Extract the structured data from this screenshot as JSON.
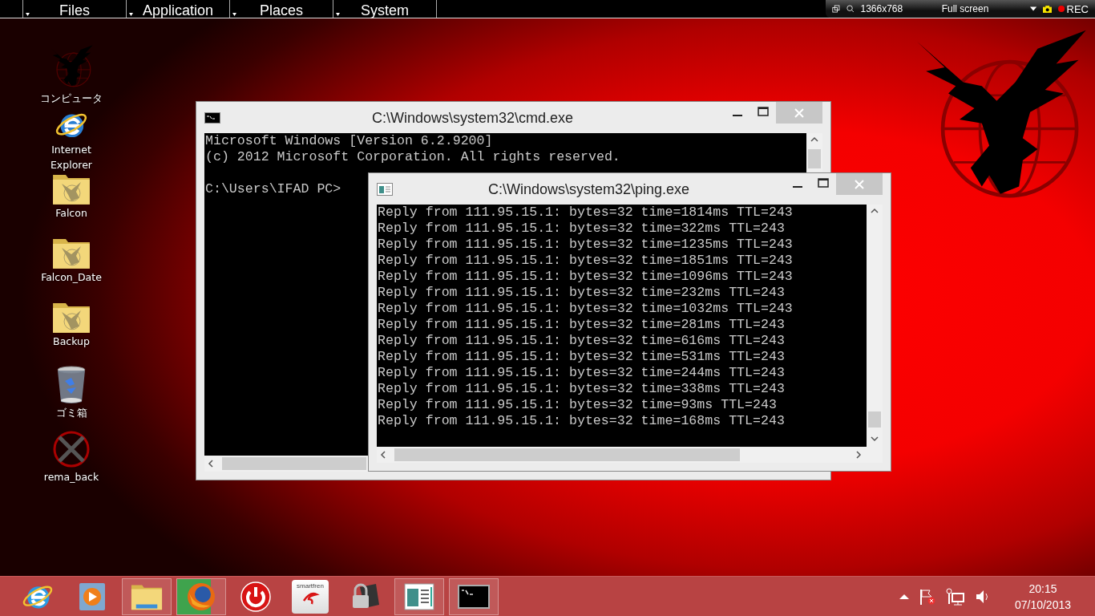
{
  "top_panel": {
    "menus": [
      "Files",
      "Application",
      "Places",
      "System"
    ],
    "recorder": {
      "size": "1366x768",
      "mode": "Full screen",
      "rec": "REC"
    }
  },
  "desktop_icons": [
    {
      "label": "コンピュータ",
      "kind": "eagle"
    },
    {
      "label": "Internet Explorer",
      "kind": "ie"
    },
    {
      "label": "Falcon",
      "kind": "folder"
    },
    {
      "label": "Falcon_Date",
      "kind": "folder"
    },
    {
      "label": "Backup",
      "kind": "folder"
    },
    {
      "label": "ゴミ箱",
      "kind": "trash"
    },
    {
      "label": "rema_back",
      "kind": "cross"
    }
  ],
  "windows": [
    {
      "title": "C:\\Windows\\system32\\cmd.exe",
      "kind": "cmd",
      "banner": [
        "Microsoft Windows [Version 6.2.9200]",
        "(c) 2012 Microsoft Corporation. All rights reserved."
      ],
      "prompt": "C:\\Users\\IFAD PC>"
    },
    {
      "title": "C:\\Windows\\system32\\ping.exe",
      "kind": "ping",
      "lines": [
        "Reply from 111.95.15.1: bytes=32 time=1814ms TTL=243",
        "Reply from 111.95.15.1: bytes=32 time=322ms TTL=243",
        "Reply from 111.95.15.1: bytes=32 time=1235ms TTL=243",
        "Reply from 111.95.15.1: bytes=32 time=1851ms TTL=243",
        "Reply from 111.95.15.1: bytes=32 time=1096ms TTL=243",
        "Reply from 111.95.15.1: bytes=32 time=232ms TTL=243",
        "Reply from 111.95.15.1: bytes=32 time=1032ms TTL=243",
        "Reply from 111.95.15.1: bytes=32 time=281ms TTL=243",
        "Reply from 111.95.15.1: bytes=32 time=616ms TTL=243",
        "Reply from 111.95.15.1: bytes=32 time=531ms TTL=243",
        "Reply from 111.95.15.1: bytes=32 time=244ms TTL=243",
        "Reply from 111.95.15.1: bytes=32 time=338ms TTL=243",
        "Reply from 111.95.15.1: bytes=32 time=93ms TTL=243",
        "Reply from 111.95.15.1: bytes=32 time=168ms TTL=243"
      ]
    }
  ],
  "taskbar": {
    "buttons": [
      {
        "kind": "ie",
        "open": false
      },
      {
        "kind": "media",
        "open": false
      },
      {
        "kind": "explorer",
        "open": true
      },
      {
        "kind": "firefox",
        "open": true,
        "level": 0.7
      },
      {
        "kind": "power",
        "open": false
      },
      {
        "kind": "smartfren",
        "open": false,
        "caption": "smartfren"
      },
      {
        "kind": "lock",
        "open": false
      },
      {
        "kind": "window",
        "open": true
      },
      {
        "kind": "cmd",
        "open": true
      }
    ],
    "clock": {
      "time": "20:15",
      "date": "07/10/2013"
    }
  }
}
